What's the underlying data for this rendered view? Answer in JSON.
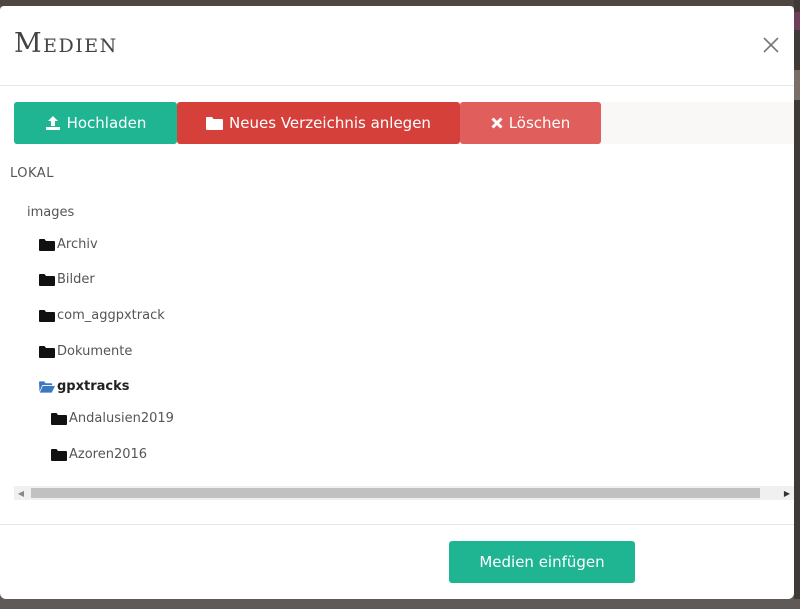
{
  "modal": {
    "title": "Medien"
  },
  "toolbar": {
    "upload_label": "Hochladen",
    "new_folder_label": "Neues Verzeichnis anlegen",
    "delete_label": "Löschen"
  },
  "tree": {
    "root_label": "LOKAL",
    "level0_label": "images",
    "folders": [
      {
        "label": "Archiv",
        "depth": 1,
        "expanded": false
      },
      {
        "label": "Bilder",
        "depth": 1,
        "expanded": false
      },
      {
        "label": "com_aggpxtrack",
        "depth": 1,
        "expanded": false
      },
      {
        "label": "Dokumente",
        "depth": 1,
        "expanded": false
      },
      {
        "label": "gpxtracks",
        "depth": 1,
        "expanded": true
      },
      {
        "label": "Andalusien2019",
        "depth": 2,
        "expanded": false
      },
      {
        "label": "Azoren2016",
        "depth": 2,
        "expanded": false
      }
    ]
  },
  "footer": {
    "insert_label": "Medien einfügen"
  },
  "colors": {
    "primary": "#1fb492",
    "danger": "#d6403a",
    "danger_light": "#e05e5b",
    "folder_open": "#3b78c2",
    "folder_closed": "#111111"
  },
  "icons": {
    "upload": "upload-icon",
    "folder": "folder-icon",
    "folder_open": "folder-open-icon",
    "delete": "times-icon",
    "close": "close-icon"
  }
}
